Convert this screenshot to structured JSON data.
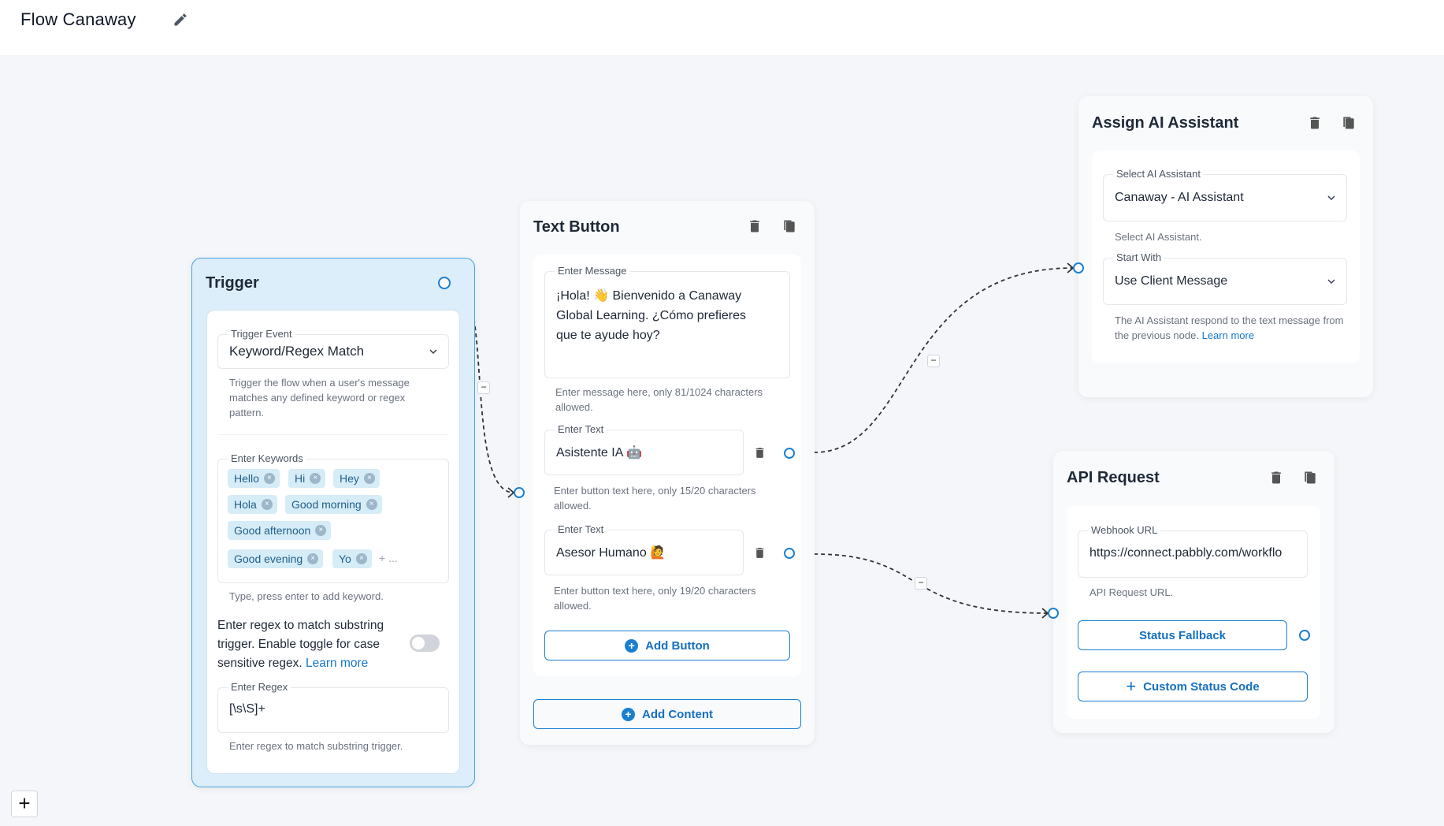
{
  "header": {
    "title": "Flow Canaway"
  },
  "trigger": {
    "title": "Trigger",
    "event_label": "Trigger Event",
    "event_value": "Keyword/Regex Match",
    "event_help": "Trigger the flow when a user's message matches any defined keyword or regex pattern.",
    "keywords_label": "Enter Keywords",
    "keywords": [
      "Hello",
      "Hi",
      "Hey",
      "Hola",
      "Good morning",
      "Good afternoon",
      "Good evening",
      "Yo"
    ],
    "keywords_more": "+ ...",
    "keywords_help": "Type, press enter to add keyword.",
    "regex_toggle_text": "Enter regex to match substring trigger. Enable toggle for case sensitive regex.",
    "learn_more": "Learn more",
    "regex_label": "Enter Regex",
    "regex_value": "[\\s\\S]+",
    "regex_help": "Enter regex to match substring trigger."
  },
  "text_button": {
    "title": "Text Button",
    "message_label": "Enter Message",
    "message_value": "¡Hola! 👋 Bienvenido a Canaway Global Learning. ¿Cómo prefieres que te ayude hoy?",
    "message_help": "Enter message here, only 81/1024 characters allowed.",
    "buttons": [
      {
        "label": "Enter Text",
        "value": "Asistente IA 🤖",
        "help": "Enter button text here, only 15/20 characters allowed."
      },
      {
        "label": "Enter Text",
        "value": "Asesor Humano 🙋",
        "help": "Enter button text here, only 19/20 characters allowed."
      }
    ],
    "add_button": "Add Button",
    "add_content": "Add Content"
  },
  "assign_ai": {
    "title": "Assign AI Assistant",
    "select_label": "Select AI Assistant",
    "select_value": "Canaway - AI Assistant",
    "select_help": "Select AI Assistant.",
    "start_label": "Start With",
    "start_value": "Use Client Message",
    "start_help": "The AI Assistant respond to the text message from the previous node.",
    "learn_more": "Learn more"
  },
  "api_request": {
    "title": "API Request",
    "webhook_label": "Webhook URL",
    "webhook_value": "https://connect.pabbly.com/workflo",
    "webhook_help": "API Request URL.",
    "status_fallback": "Status Fallback",
    "custom_status": "Custom Status Code"
  },
  "controls": {
    "zoom_in": "+"
  },
  "colors": {
    "accent": "#1b7fd1",
    "chip_bg": "#d6ecf7",
    "trigger_bg": "#dceefa",
    "canvas_bg": "#f4f6f9"
  }
}
